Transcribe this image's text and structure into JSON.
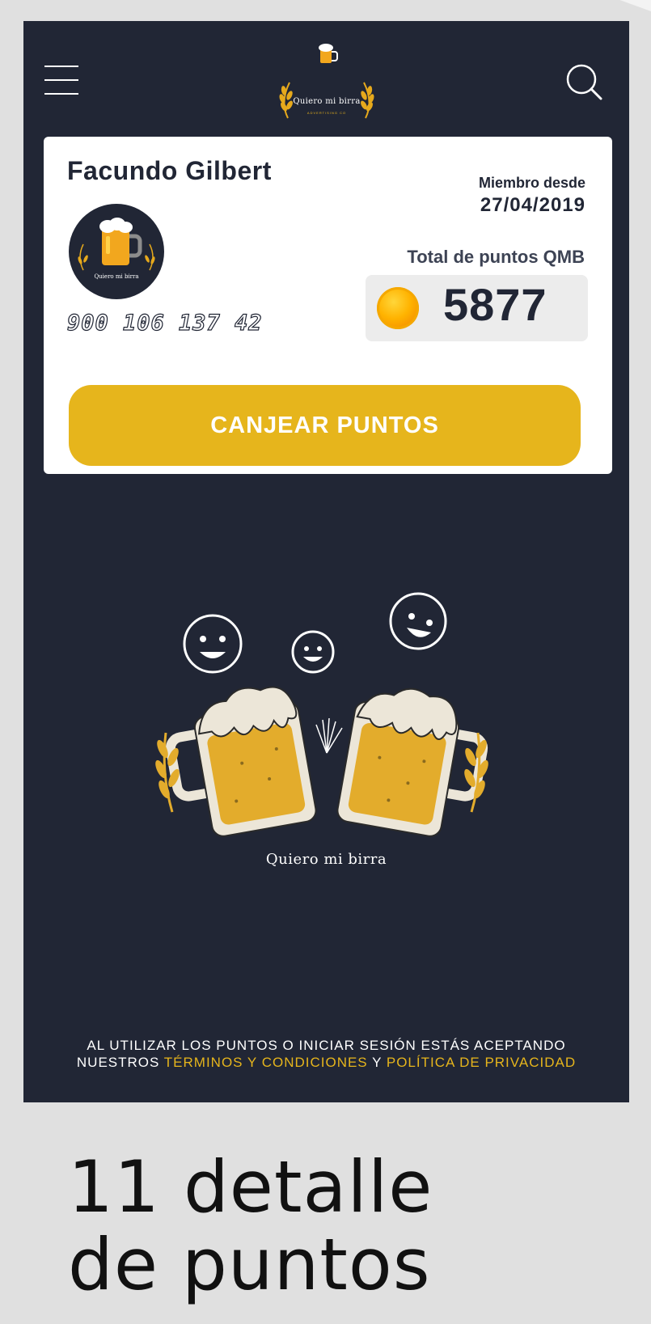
{
  "header": {
    "logo_text": "Quiero mi birra",
    "logo_subtext": "ADVERTISING CO"
  },
  "profile": {
    "name": "Facundo Gilbert",
    "avatar_text": "Quiero mi birra",
    "card_number": "900 106 137 42",
    "member_label": "Miembro desde",
    "member_date": "27/04/2019",
    "points_label": "Total de puntos QMB",
    "points_value": "5877"
  },
  "actions": {
    "redeem_label": "CANJEAR PUNTOS"
  },
  "illustration": {
    "caption": "Quiero mi birra"
  },
  "legal": {
    "line1": "AL UTILIZAR LOS PUNTOS O INICIAR SESIÓN ESTÁS ACEPTANDO",
    "prefix": "NUESTROS",
    "terms_link": "TÉRMINOS Y CONDICIONES",
    "and": "Y",
    "privacy_link": "POLÍTICA DE PRIVACIDAD"
  },
  "caption": {
    "line1": "11 detalle",
    "line2": "de puntos"
  },
  "colors": {
    "background": "#212635",
    "accent": "#e6b51c",
    "card": "#ffffff"
  }
}
